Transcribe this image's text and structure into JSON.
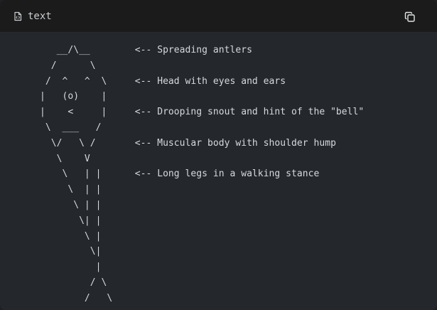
{
  "header": {
    "language_label": "text",
    "file_icon": "code-file-icon",
    "copy_icon": "copy-icon"
  },
  "code": {
    "ascii_art": "   __/\\__        <-- Spreading antlers\n  /      \\\n /  ^   ^  \\     <-- Head with eyes and ears\n|   (o)    |\n|    <     |     <-- Drooping snout and hint of the \"bell\"\n \\  ___   /\n  \\/   \\ /       <-- Muscular body with shoulder hump\n   \\    V\n    \\   | |      <-- Long legs in a walking stance\n     \\  | |\n      \\ | |\n       \\| |\n        \\ |\n         \\|\n          |\n         / \\\n        /   \\"
  },
  "colors": {
    "header_bg": "#1b1b1b",
    "body_bg": "#24272b",
    "text": "#d6d9dd"
  }
}
